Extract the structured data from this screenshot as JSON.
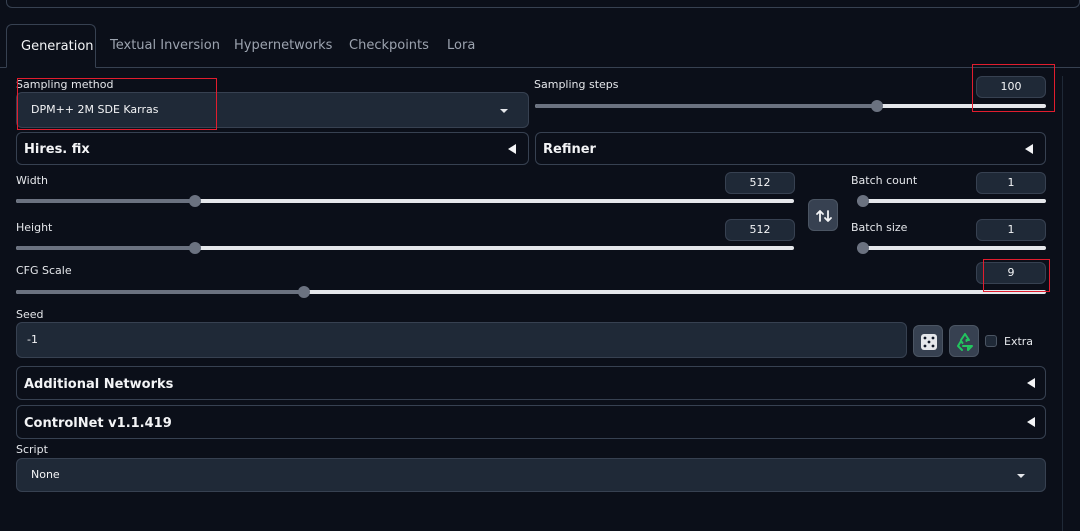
{
  "tabs": [
    {
      "label": "Generation"
    },
    {
      "label": "Textual Inversion"
    },
    {
      "label": "Hypernetworks"
    },
    {
      "label": "Checkpoints"
    },
    {
      "label": "Lora"
    }
  ],
  "sampling_method": {
    "label": "Sampling method",
    "value": "DPM++ 2M SDE Karras"
  },
  "sampling_steps": {
    "label": "Sampling steps",
    "value": "100",
    "fraction": 0.67
  },
  "hires_fix": {
    "label": "Hires. fix"
  },
  "refiner": {
    "label": "Refiner"
  },
  "width": {
    "label": "Width",
    "value": "512",
    "fraction": 0.23
  },
  "height": {
    "label": "Height",
    "value": "512",
    "fraction": 0.23
  },
  "batch_count": {
    "label": "Batch count",
    "value": "1",
    "fraction": 0.0
  },
  "batch_size": {
    "label": "Batch size",
    "value": "1",
    "fraction": 0.0
  },
  "cfg_scale": {
    "label": "CFG Scale",
    "value": "9",
    "fraction": 0.28
  },
  "seed": {
    "label": "Seed",
    "value": "-1",
    "extra_label": "Extra"
  },
  "additional_networks": {
    "label": "Additional Networks"
  },
  "controlnet": {
    "label": "ControlNet v1.1.419"
  },
  "script": {
    "label": "Script",
    "value": "None"
  },
  "icons": {
    "swap": "swap-dimensions-icon",
    "dice": "dice-icon",
    "recycle": "recycle-icon"
  },
  "colors": {
    "highlight": "#e11d2e",
    "background": "#0b0f19",
    "field": "#1f2937"
  }
}
